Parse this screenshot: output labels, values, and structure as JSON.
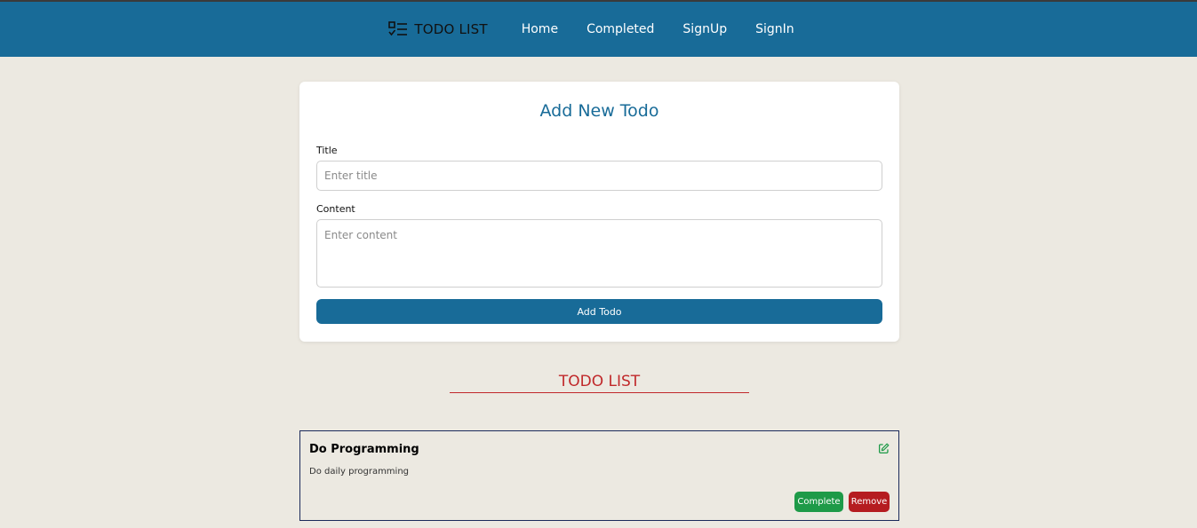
{
  "nav": {
    "brand": "TODO LIST",
    "brand_icon": "checklist-icon",
    "links": [
      "Home",
      "Completed",
      "SignUp",
      "SignIn"
    ]
  },
  "form": {
    "heading": "Add New Todo",
    "title_label": "Title",
    "title_placeholder": "Enter title",
    "content_label": "Content",
    "content_placeholder": "Enter content",
    "submit_label": "Add Todo"
  },
  "list": {
    "heading": "TODO LIST",
    "items": [
      {
        "title": "Do Programming",
        "content": "Do daily programming",
        "complete_label": "Complete",
        "remove_label": "Remove",
        "edit_icon": "edit-icon"
      }
    ]
  },
  "colors": {
    "primary": "#186b98",
    "background": "#ece9e1",
    "heading_red": "#c0282a",
    "complete_green": "#1e9a48",
    "remove_red": "#b51c20"
  }
}
